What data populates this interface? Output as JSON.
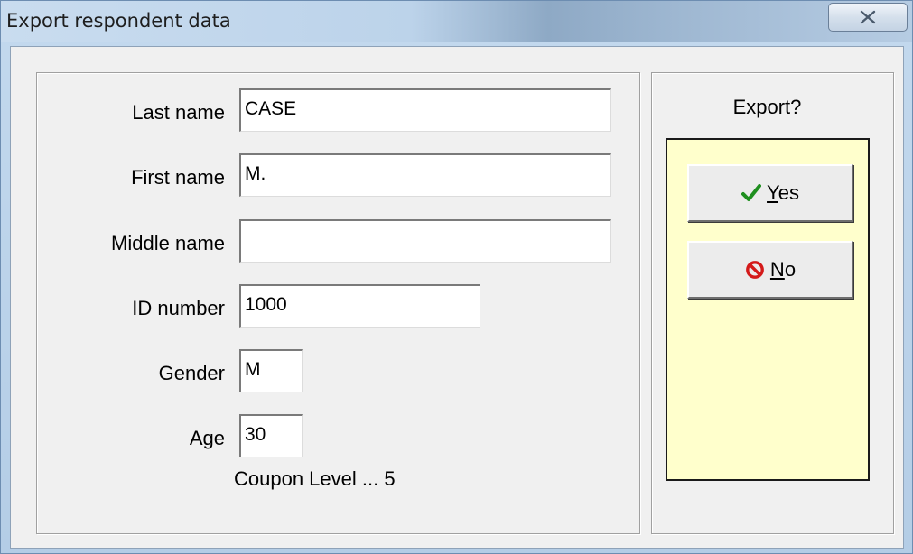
{
  "window": {
    "title": "Export respondent data"
  },
  "form": {
    "last_name": {
      "label": "Last name",
      "value": "CASE"
    },
    "first_name": {
      "label": "First name",
      "value": "M."
    },
    "middle_name": {
      "label": "Middle name",
      "value": ""
    },
    "id_number": {
      "label": "ID number",
      "value": "1000"
    },
    "gender": {
      "label": "Gender",
      "value": "M"
    },
    "age": {
      "label": "Age",
      "value": "30"
    },
    "coupon_level": "Coupon Level ... 5"
  },
  "export": {
    "prompt": "Export?",
    "yes": {
      "mnemonic": "Y",
      "rest": "es",
      "icon": "checkmark-icon",
      "icon_color": "#1f8f1f"
    },
    "no": {
      "mnemonic": "N",
      "rest": "o",
      "icon": "no-entry-icon",
      "icon_color": "#d41a1a"
    },
    "panel_color": "#ffffcc"
  }
}
